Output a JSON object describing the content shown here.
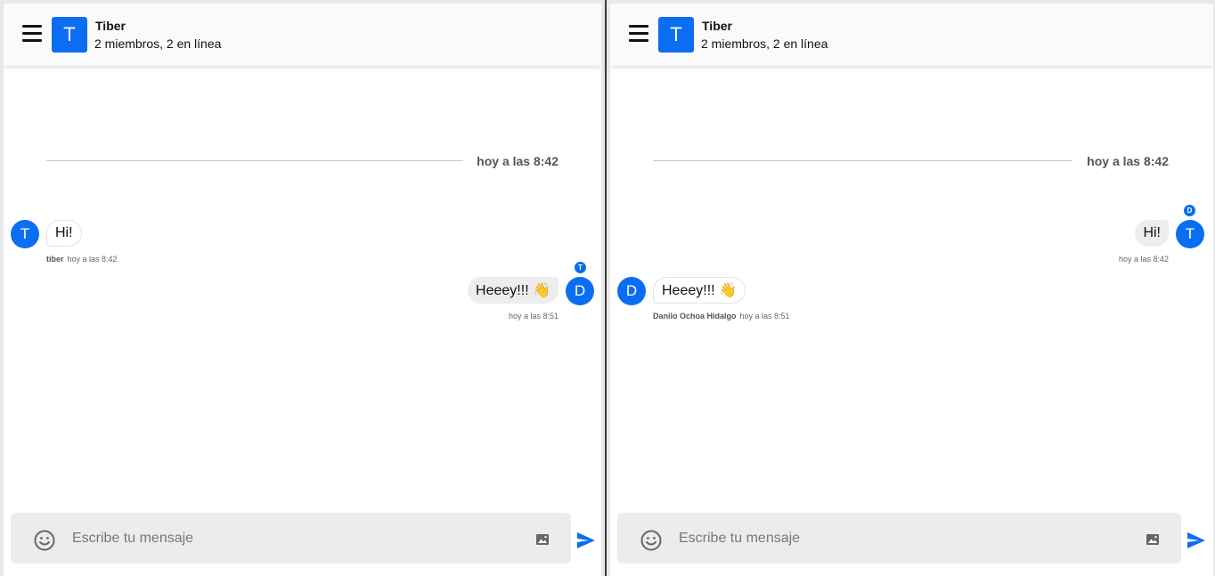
{
  "left": {
    "group": {
      "initial": "T",
      "name": "Tiber",
      "status": "2 miembros, 2 en línea"
    },
    "date_separator": "hoy a las 8:42",
    "messages": [
      {
        "avatar": "T",
        "text": "Hi!",
        "author": "tiber",
        "time": "hoy a las 8:42"
      },
      {
        "avatar": "D",
        "read_badge": "T",
        "text": "Heeey!!! 👋",
        "time": "hoy a las 8:51"
      }
    ],
    "composer": {
      "placeholder": "Escribe tu mensaje"
    }
  },
  "right": {
    "group": {
      "initial": "T",
      "name": "Tiber",
      "status": "2 miembros, 2 en línea"
    },
    "date_separator": "hoy a las 8:42",
    "messages": [
      {
        "avatar": "T",
        "read_badge": "D",
        "text": "Hi!",
        "time": "hoy a las 8:42"
      },
      {
        "avatar": "D",
        "text": "Heeey!!! 👋",
        "author": "Danilo Ochoa Hidalgo",
        "time": "hoy a las 8:51"
      }
    ],
    "composer": {
      "placeholder": "Escribe tu mensaje"
    }
  },
  "colors": {
    "accent": "#0b6ef2",
    "outgoing_bubble": "#ededed",
    "composer": "#ececec"
  },
  "icons": [
    "menu-icon",
    "smiley-icon",
    "image-icon",
    "send-icon"
  ]
}
